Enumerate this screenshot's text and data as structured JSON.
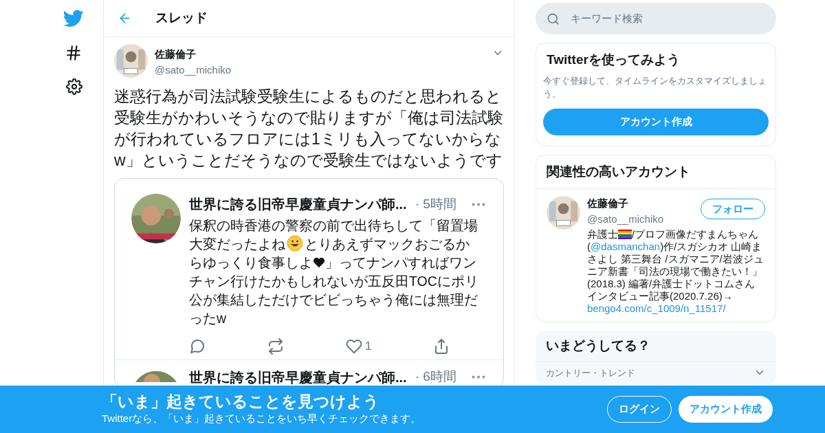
{
  "nav": {
    "header_title": "スレッド"
  },
  "tweet": {
    "name": "佐藤倫子",
    "handle": "@sato__michiko",
    "text": "迷惑行為が司法試験受験生によるものだと思われると受験生がかわいそうなので貼りますが「俺は司法試験が行われているフロアには1ミリも入ってないからなw」ということだそうなので受験生ではないようです"
  },
  "embedded_tweets": [
    {
      "name": "世界に誇る旧帝早慶童貞ナンパ師...",
      "time": "· 5時間",
      "segments": [
        {
          "kind": "text",
          "text": "保釈の時香港の警察の前で出待ちして「留置場大変だったよね"
        },
        {
          "kind": "smiley"
        },
        {
          "kind": "text",
          "text": "とりあえずマックおごるからゆっくり食事しよ"
        },
        {
          "kind": "heart"
        },
        {
          "kind": "text",
          "text": "」ってナンパすればワンチャン行けたかもしれないが五反田TOCにポリ公が集結しただけでビビっちゃう俺には無理だったw"
        }
      ],
      "like_count": "1"
    },
    {
      "name": "世界に誇る旧帝早慶童貞ナンパ師...",
      "time": "· 6時間"
    }
  ],
  "search": {
    "placeholder": "キーワード検索"
  },
  "signup_card": {
    "title": "Twitterを使ってみよう",
    "text": "今すぐ登録して、タイムラインをカスタマイズしましょう。",
    "button": "アカウント作成"
  },
  "related": {
    "title": "関連性の高いアカウント",
    "name": "佐藤倫子",
    "handle": "@sato__michiko",
    "follow": "フォロー",
    "bio": [
      {
        "kind": "text",
        "text": "弁護士"
      },
      {
        "kind": "flag"
      },
      {
        "kind": "text",
        "text": "/プロフ画像だすまんちゃん("
      },
      {
        "kind": "link",
        "text": "@dasmanchan"
      },
      {
        "kind": "text",
        "text": ")作/スガシカオ 山崎まさよし 第三舞台 /スガマニア/岩波ジュニア新書「司法の現場で働きたい！」(2018.3) 編著/弁護士ドットコムさんインタビュー記事(2020.7.26)→ "
      },
      {
        "kind": "link",
        "text": "bengo4.com/c_1009/n_11517/"
      }
    ]
  },
  "trends": {
    "title": "いまどうしてる？",
    "subtitle": "カントリー・トレンド"
  },
  "banner": {
    "title": "「いま」起きていることを見つけよう",
    "text": "Twitterなら、「いま」起きていることをいち早くチェックできます。",
    "login": "ログイン",
    "signup": "アカウント作成"
  }
}
